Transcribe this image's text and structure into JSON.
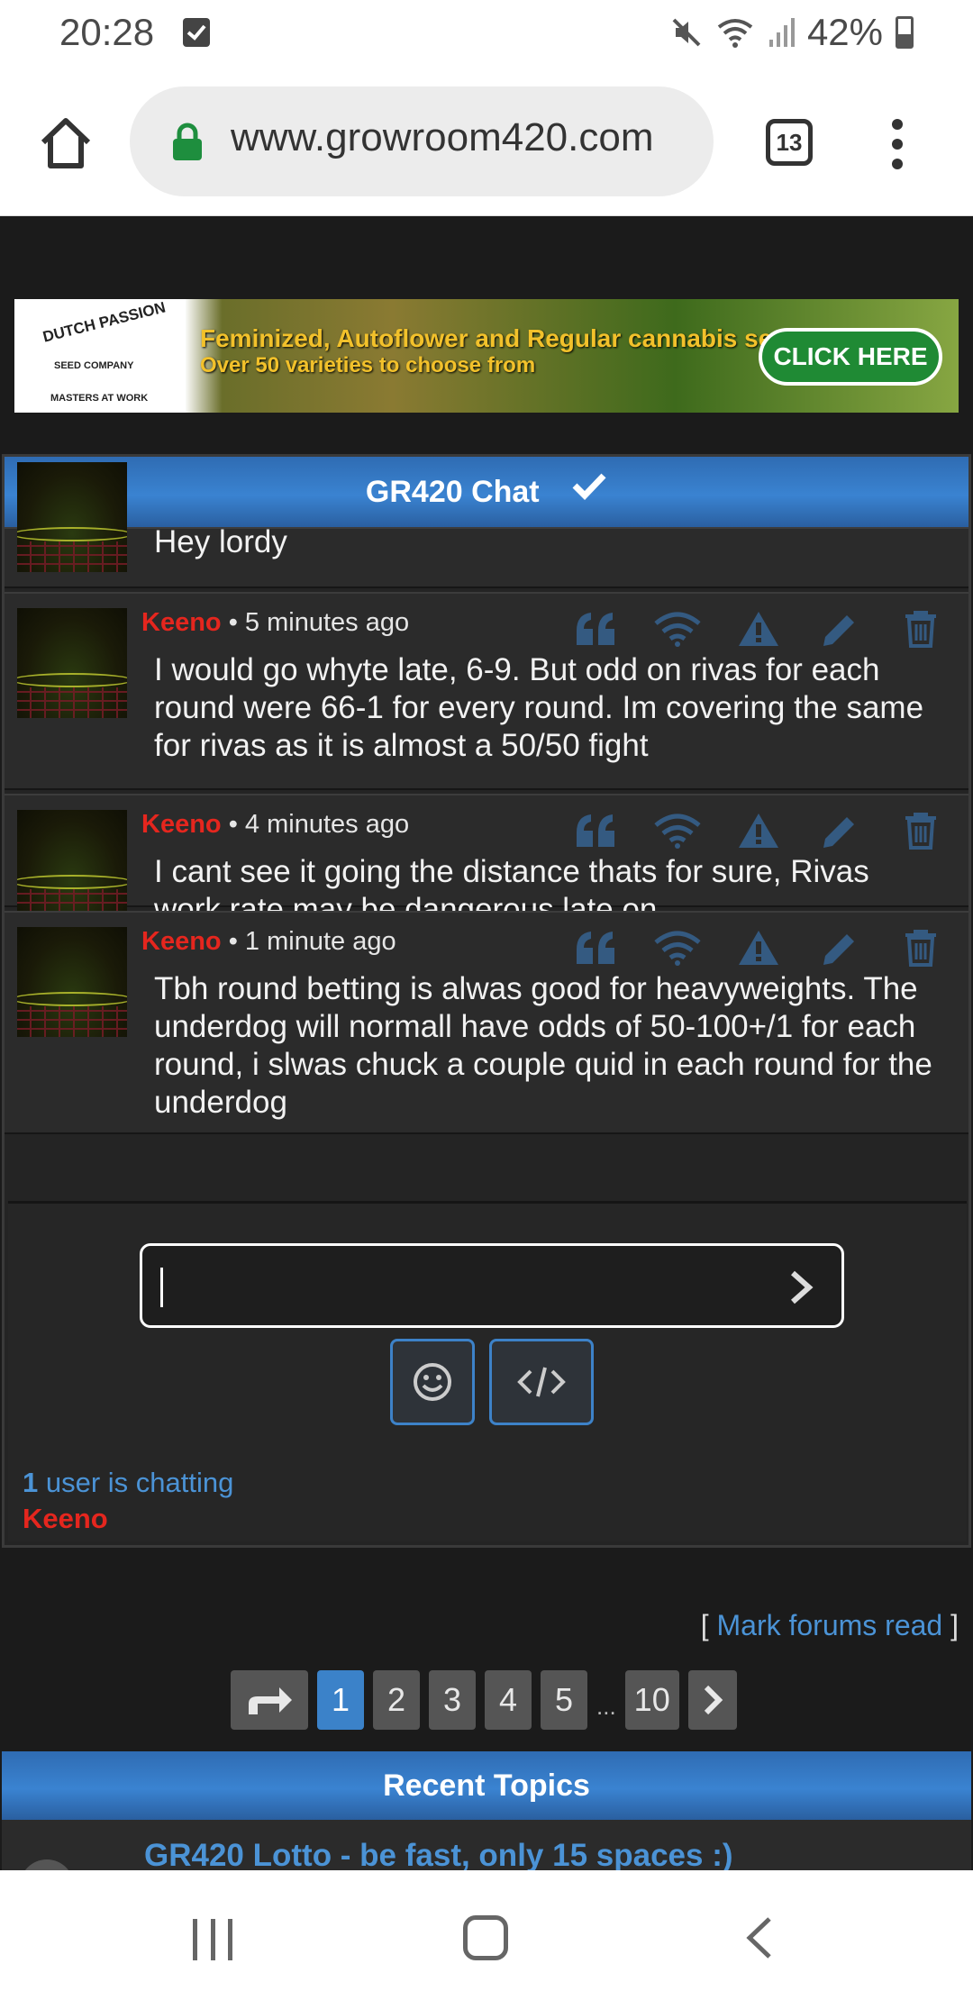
{
  "status": {
    "time": "20:28",
    "battery": "42%",
    "icons": [
      "notification-check-icon",
      "mute-icon",
      "wifi-icon",
      "signal-icon",
      "battery-icon"
    ]
  },
  "browser": {
    "url": "www.growroom420.com",
    "tabs_count": "13",
    "icons": [
      "home-icon",
      "lock-icon",
      "more-vert-icon"
    ]
  },
  "banner": {
    "brand_line1": "DUTCH PASSION",
    "brand_line2": "SEED COMPANY",
    "brand_line3": "MASTERS AT WORK",
    "line1": "Feminized, Autoflower and Regular cannabis seeds",
    "line2": "Over 50 varieties to choose from",
    "cta": "CLICK HERE"
  },
  "chat": {
    "title": "GR420 Chat",
    "messages": [
      {
        "author": "",
        "time": "",
        "text": "Hey lordy"
      },
      {
        "author": "Keeno",
        "time": " • 5 minutes ago",
        "text": "I would go whyte late, 6-9. But odd on rivas for each round were 66-1 for every round. Im covering the same for rivas as it is almost a 50/50 fight"
      },
      {
        "author": "Keeno",
        "time": " • 4 minutes ago",
        "text": "I cant see it going the distance thats for sure, Rivas work rate may be dangerous late on"
      },
      {
        "author": "Keeno",
        "time": " • 1 minute ago",
        "text": "Tbh round betting is alwas good for heavyweights. The underdog will normall have odds of 50-100+/1 for each round, i slwas chuck a couple quid in each round for the underdog"
      }
    ],
    "action_icons": [
      "quote-icon",
      "wifi-broadcast-icon",
      "warning-icon",
      "pencil-icon",
      "trash-icon"
    ],
    "input_value": "",
    "chatting_count": "1",
    "chatting_text": " user is chatting",
    "chatting_user": "Keeno"
  },
  "forum": {
    "mark_read_open": "[ ",
    "mark_read": "Mark forums read",
    "mark_read_close": " ]",
    "pages": [
      "1",
      "2",
      "3",
      "4",
      "5"
    ],
    "ellipsis": "...",
    "last_page": "10",
    "current_page": "1",
    "recent_title": "Recent Topics",
    "recent_topic": "GR420 Lotto - be fast, only 15 spaces :)"
  },
  "colors": {
    "accent": "#3b82c9",
    "author": "#e5261e",
    "link": "#4b93d6",
    "background": "#1b1b1b"
  }
}
